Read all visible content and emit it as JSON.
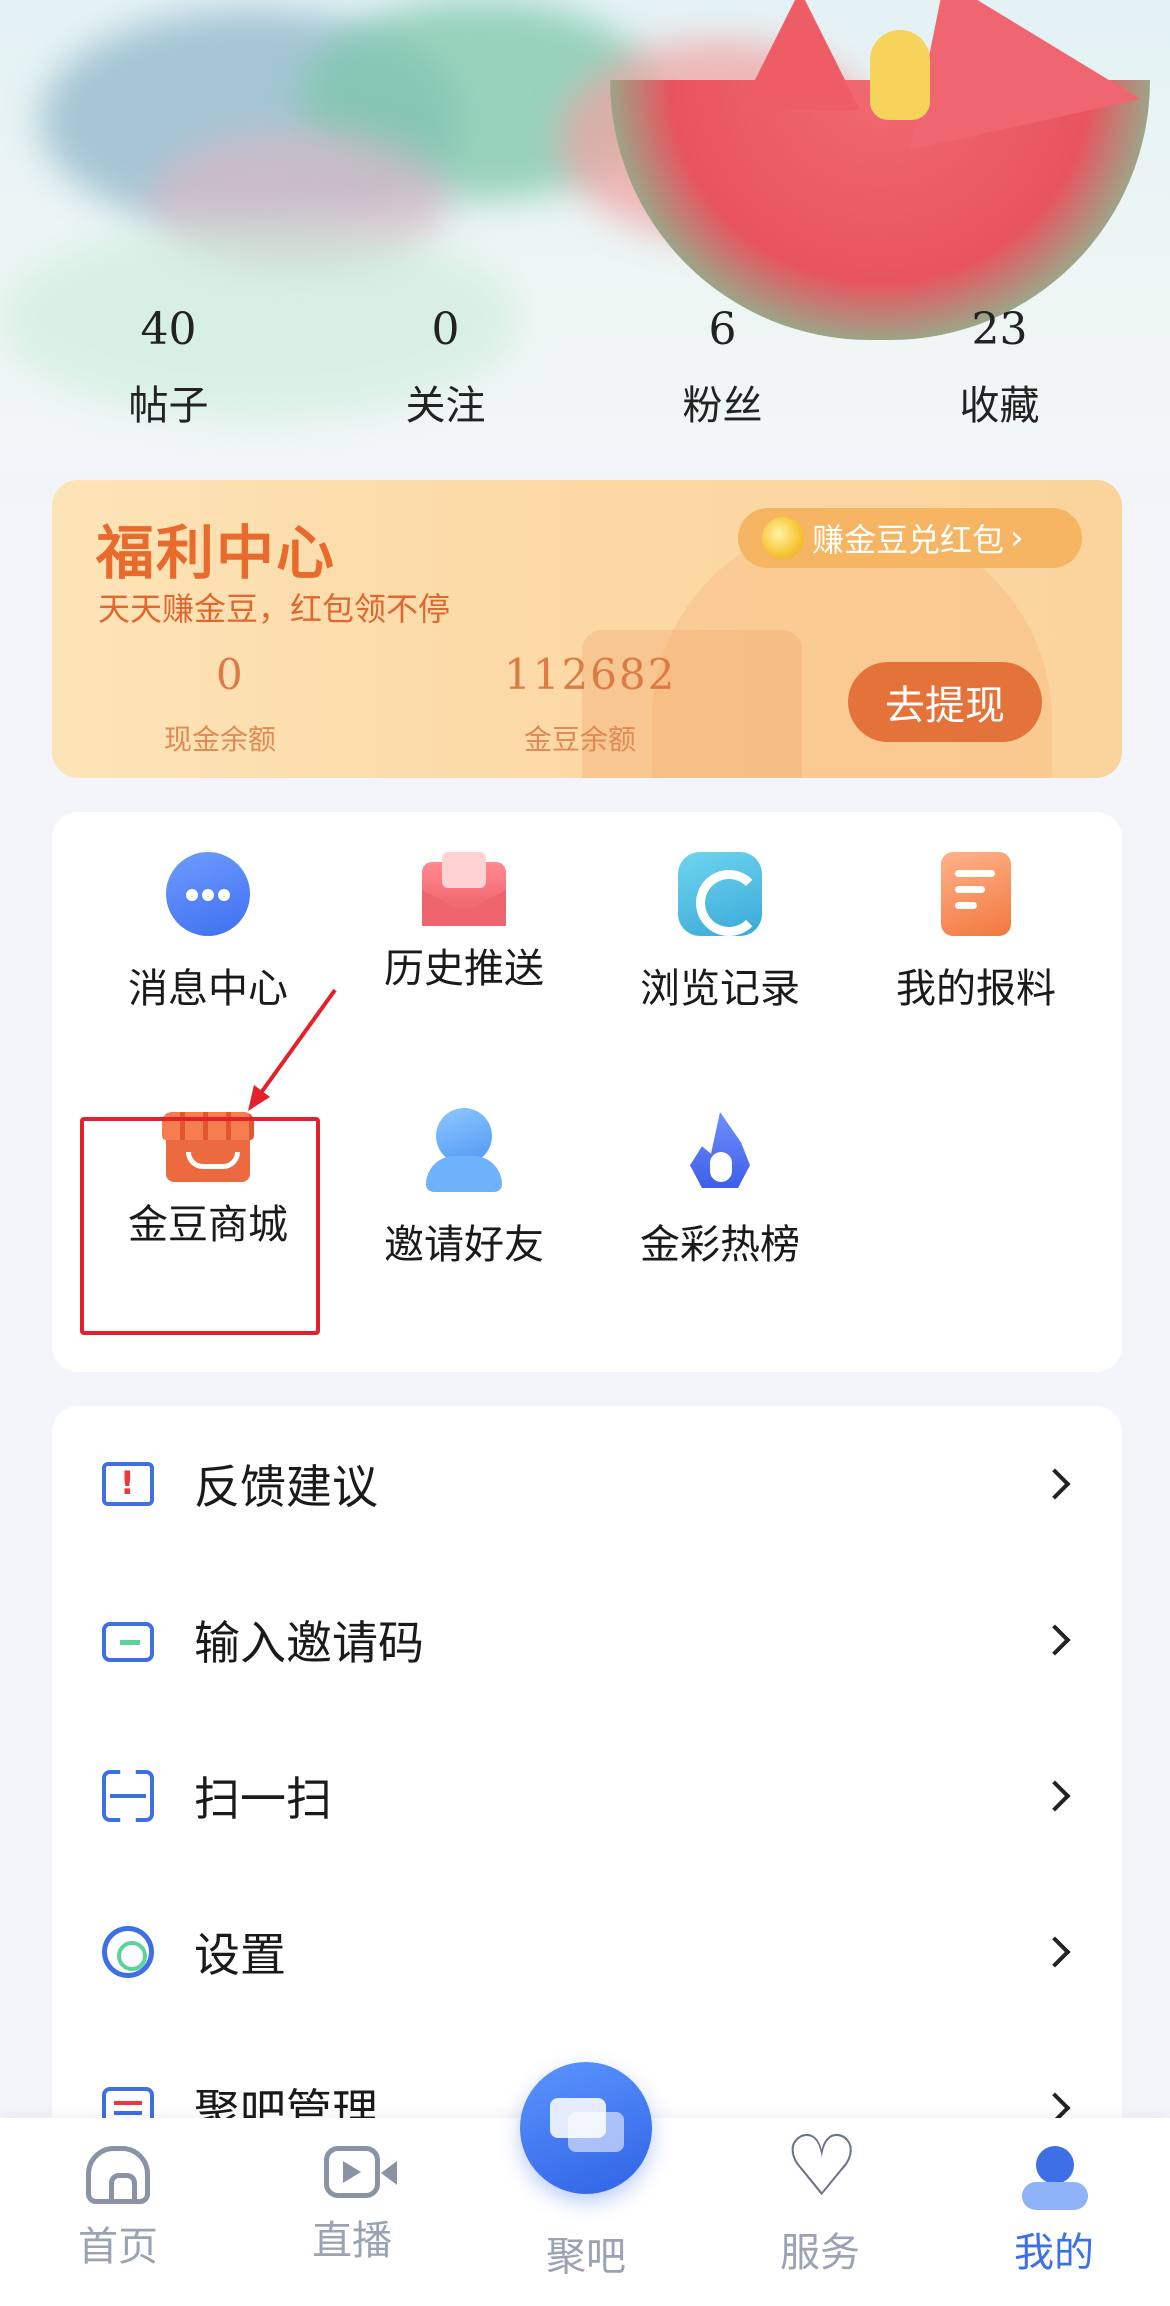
{
  "stats": [
    {
      "value": "40",
      "label": "帖子"
    },
    {
      "value": "0",
      "label": "关注"
    },
    {
      "value": "6",
      "label": "粉丝"
    },
    {
      "value": "23",
      "label": "收藏"
    }
  ],
  "welfare": {
    "title": "福利中心",
    "subtitle": "天天赚金豆，红包领不停",
    "earn_pill": "赚金豆兑红包",
    "cash_value": "0",
    "cash_label": "现金余额",
    "bean_value": "112682",
    "bean_label": "金豆余额",
    "withdraw_label": "去提现"
  },
  "shortcuts": [
    {
      "label": "消息中心",
      "icon": "message-center-icon"
    },
    {
      "label": "历史推送",
      "icon": "history-push-icon"
    },
    {
      "label": "浏览记录",
      "icon": "browse-history-icon"
    },
    {
      "label": "我的报料",
      "icon": "my-report-icon"
    },
    {
      "label": "金豆商城",
      "icon": "bean-mall-icon"
    },
    {
      "label": "邀请好友",
      "icon": "invite-friends-icon"
    },
    {
      "label": "金彩热榜",
      "icon": "hot-list-icon"
    }
  ],
  "menu": [
    {
      "label": "反馈建议",
      "icon": "feedback-icon"
    },
    {
      "label": "输入邀请码",
      "icon": "invite-code-icon"
    },
    {
      "label": "扫一扫",
      "icon": "scan-icon"
    },
    {
      "label": "设置",
      "icon": "settings-icon"
    },
    {
      "label": "聚吧管理",
      "icon": "juba-manage-icon"
    }
  ],
  "tabs": [
    {
      "label": "首页",
      "icon": "home-icon"
    },
    {
      "label": "直播",
      "icon": "live-icon"
    },
    {
      "label": "聚吧",
      "icon": "juba-icon"
    },
    {
      "label": "服务",
      "icon": "heart-icon"
    },
    {
      "label": "我的",
      "icon": "profile-icon"
    }
  ],
  "active_tab": "我的",
  "colors": {
    "accent_blue": "#3d6fe6",
    "welfare_orange": "#e4733a",
    "highlight_red": "#e4202a"
  }
}
